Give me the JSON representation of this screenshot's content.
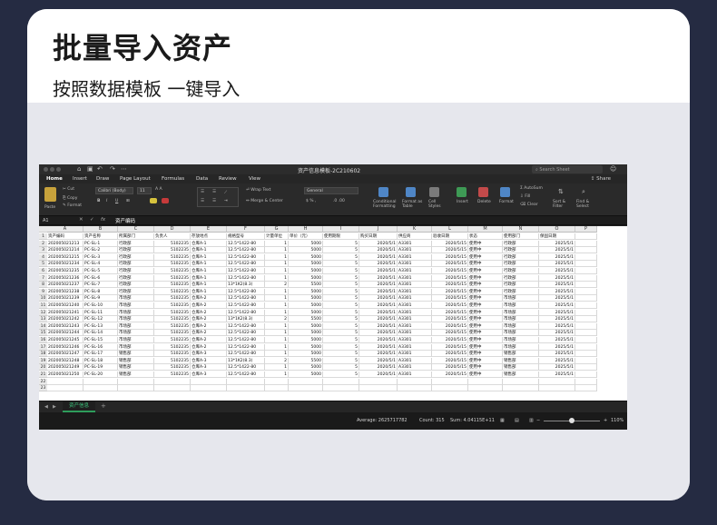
{
  "header": {
    "title": "批量导入资产",
    "subtitle": "按照数据模板 一键导入"
  },
  "excel": {
    "doc_title": "资产信息模板-2C210602",
    "search_placeholder": "Search Sheet",
    "tabs": [
      "Home",
      "Insert",
      "Draw",
      "Page Layout",
      "Formulas",
      "Data",
      "Review",
      "View"
    ],
    "share_label": "Share",
    "ribbon": {
      "paste": "Paste",
      "cut": "Cut",
      "copy": "Copy",
      "format": "Format",
      "font": "Calibri (Body)",
      "font_size": "11",
      "wrap_text": "Wrap Text",
      "merge_center": "Merge & Center",
      "number_format": "General",
      "conditional_formatting": "Conditional Formatting",
      "format_as_table": "Format as Table",
      "cell_styles": "Cell Styles",
      "insert": "Insert",
      "delete": "Delete",
      "format_cells": "Format",
      "autosum": "AutoSum",
      "fill": "Fill",
      "clear": "Clear",
      "sort_filter": "Sort & Filter",
      "find_select": "Find & Select"
    },
    "name_box": "A1",
    "fx": "fx",
    "formula_content": "资产编码",
    "columns": [
      "A",
      "B",
      "C",
      "D",
      "E",
      "F",
      "G",
      "H",
      "I",
      "J",
      "K",
      "L",
      "M",
      "N",
      "O",
      "P"
    ],
    "headers": [
      "资产编码",
      "资产名称",
      "所属部门",
      "负责人",
      "存放地点",
      "规格型号",
      "计量单位",
      "单价（元）",
      "使用期限",
      "购买日期",
      "供应商",
      "验收日期",
      "状态",
      "使用部门",
      "保固日期"
    ],
    "rows": [
      [
        "202005021213",
        "PC-SL-1",
        "行政部",
        "5102235",
        "仓库A-1",
        "12.5*1422-80",
        "1",
        "5000",
        "5",
        "2020/5/1",
        "A3301",
        "2020/5/15",
        "使用中",
        "行政部",
        "2025/5/1"
      ],
      [
        "202005021214",
        "PC-SL-2",
        "行政部",
        "5102235",
        "仓库A-1",
        "12.5*1422-80",
        "1",
        "5000",
        "5",
        "2020/5/1",
        "A3301",
        "2020/5/15",
        "使用中",
        "行政部",
        "2025/5/1"
      ],
      [
        "202005021215",
        "PC-SL-3",
        "行政部",
        "5102235",
        "仓库A-1",
        "12.5*1422-80",
        "1",
        "5000",
        "5",
        "2020/5/1",
        "A3301",
        "2020/5/15",
        "使用中",
        "行政部",
        "2025/5/1"
      ],
      [
        "202005021234",
        "PC-SL-4",
        "行政部",
        "5102235",
        "仓库A-1",
        "12.5*1422-80",
        "1",
        "5000",
        "5",
        "2020/5/1",
        "A3301",
        "2020/5/15",
        "使用中",
        "行政部",
        "2025/5/1"
      ],
      [
        "202005021235",
        "PC-SL-5",
        "行政部",
        "5102235",
        "仓库A-1",
        "12.5*1422-80",
        "1",
        "5000",
        "5",
        "2020/5/1",
        "A3301",
        "2020/5/15",
        "使用中",
        "行政部",
        "2025/5/1"
      ],
      [
        "202005021236",
        "PC-SL-6",
        "行政部",
        "5102235",
        "仓库A-1",
        "12.5*1422-80",
        "1",
        "5000",
        "5",
        "2020/5/1",
        "A3301",
        "2020/5/15",
        "使用中",
        "行政部",
        "2025/5/1"
      ],
      [
        "202005021237",
        "PC-SL-7",
        "行政部",
        "5102235",
        "仓库A-1",
        "13*1K2(8.3)",
        "2",
        "5500",
        "5",
        "2020/5/1",
        "A3301",
        "2020/5/15",
        "使用中",
        "行政部",
        "2025/5/1"
      ],
      [
        "202005021238",
        "PC-SL-8",
        "行政部",
        "5102235",
        "仓库A-1",
        "12.5*1422-80",
        "1",
        "5000",
        "5",
        "2020/5/1",
        "A3301",
        "2020/5/15",
        "使用中",
        "行政部",
        "2025/5/1"
      ],
      [
        "202005021239",
        "PC-SL-9",
        "市场部",
        "5102235",
        "仓库A-2",
        "12.5*1422-80",
        "1",
        "5000",
        "5",
        "2020/5/1",
        "A3301",
        "2020/5/15",
        "使用中",
        "市场部",
        "2025/5/1"
      ],
      [
        "202005021240",
        "PC-SL-10",
        "市场部",
        "5102235",
        "仓库A-2",
        "12.5*1422-80",
        "1",
        "5000",
        "5",
        "2020/5/1",
        "A3301",
        "2020/5/15",
        "使用中",
        "市场部",
        "2025/5/1"
      ],
      [
        "202005021241",
        "PC-SL-11",
        "市场部",
        "5102235",
        "仓库A-2",
        "12.5*1422-80",
        "1",
        "5000",
        "5",
        "2020/5/1",
        "A3301",
        "2020/5/15",
        "使用中",
        "市场部",
        "2025/5/1"
      ],
      [
        "202005021242",
        "PC-SL-12",
        "市场部",
        "5102235",
        "仓库A-2",
        "13*1K2(8.3)",
        "2",
        "5500",
        "5",
        "2020/5/1",
        "A3301",
        "2020/5/15",
        "使用中",
        "市场部",
        "2025/5/1"
      ],
      [
        "202005021243",
        "PC-SL-13",
        "市场部",
        "5102235",
        "仓库A-2",
        "12.5*1422-80",
        "1",
        "5000",
        "5",
        "2020/5/1",
        "A3301",
        "2020/5/15",
        "使用中",
        "市场部",
        "2025/5/1"
      ],
      [
        "202005021244",
        "PC-SL-14",
        "市场部",
        "5102235",
        "仓库A-2",
        "12.5*1422-80",
        "1",
        "5000",
        "5",
        "2020/5/1",
        "A3301",
        "2020/5/15",
        "使用中",
        "市场部",
        "2025/5/1"
      ],
      [
        "202005021245",
        "PC-SL-15",
        "市场部",
        "5102235",
        "仓库A-2",
        "12.5*1422-80",
        "1",
        "5000",
        "5",
        "2020/5/1",
        "A3301",
        "2020/5/15",
        "使用中",
        "市场部",
        "2025/5/1"
      ],
      [
        "202005021246",
        "PC-SL-16",
        "市场部",
        "5102235",
        "仓库A-2",
        "12.5*1422-80",
        "1",
        "5000",
        "5",
        "2020/5/1",
        "A3301",
        "2020/5/15",
        "使用中",
        "市场部",
        "2025/5/1"
      ],
      [
        "202005021247",
        "PC-SL-17",
        "销售部",
        "5102235",
        "仓库A-3",
        "12.5*1422-80",
        "1",
        "5000",
        "5",
        "2020/5/1",
        "A3301",
        "2020/5/15",
        "使用中",
        "销售部",
        "2025/5/1"
      ],
      [
        "202005021248",
        "PC-SL-18",
        "销售部",
        "5102235",
        "仓库A-3",
        "13*1K2(8.3)",
        "2",
        "5500",
        "5",
        "2020/5/1",
        "A3301",
        "2020/5/15",
        "使用中",
        "销售部",
        "2025/5/1"
      ],
      [
        "202005021249",
        "PC-SL-19",
        "销售部",
        "5102235",
        "仓库A-3",
        "12.5*1422-80",
        "1",
        "5000",
        "5",
        "2020/5/1",
        "A3301",
        "2020/5/15",
        "使用中",
        "销售部",
        "2025/5/1"
      ],
      [
        "202005021250",
        "PC-SL-20",
        "销售部",
        "5102235",
        "仓库A-3",
        "12.5*1422-80",
        "1",
        "5000",
        "5",
        "2020/5/1",
        "A3301",
        "2020/5/15",
        "使用中",
        "销售部",
        "2025/5/1"
      ]
    ],
    "sheet_tab": "资产信息",
    "status": {
      "average": "Average: 2625717782",
      "count": "Count: 315",
      "sum": "Sum: 4.04115E+11",
      "zoom": "110%"
    }
  }
}
